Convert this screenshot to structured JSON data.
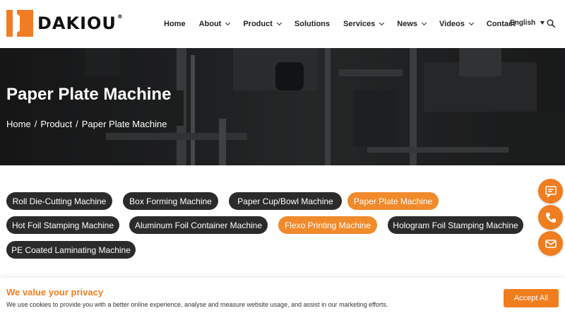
{
  "brand": {
    "name": "DAKIOU",
    "reg": "®",
    "accent": "#f07d1e",
    "dark": "#2b2b2b"
  },
  "nav": {
    "items": [
      {
        "label": "Home",
        "has_dropdown": false
      },
      {
        "label": "About",
        "has_dropdown": true
      },
      {
        "label": "Product",
        "has_dropdown": true
      },
      {
        "label": "Solutions",
        "has_dropdown": false
      },
      {
        "label": "Services",
        "has_dropdown": true
      },
      {
        "label": "News",
        "has_dropdown": true
      },
      {
        "label": "Videos",
        "has_dropdown": true
      },
      {
        "label": "Contact",
        "has_dropdown": false
      }
    ],
    "language": "English",
    "search_icon": "search-icon"
  },
  "hero": {
    "title": "Paper Plate Machine",
    "breadcrumb": [
      "Home",
      "/",
      "Product",
      "/",
      "Paper Plate Machine"
    ]
  },
  "categories": [
    {
      "label": "Roll Die-Cutting Machine",
      "active": false
    },
    {
      "label": "Box Forming Machine",
      "active": false
    },
    {
      "label": "Paper Cup/Bowl Machine",
      "active": false
    },
    {
      "label": "Paper Plate Machine",
      "active": true
    },
    {
      "label": "Hot Foil Stamping Machine",
      "active": false
    },
    {
      "label": "Aluminum Foil Container Machine",
      "active": false
    },
    {
      "label": "Flexo Printing Machine",
      "active": true
    },
    {
      "label": "Hologram Foil Stamping Machine",
      "active": false
    },
    {
      "label": "PE Coated Laminating Machine",
      "active": false
    }
  ],
  "floating_actions": [
    "message-icon",
    "phone-icon",
    "email-icon"
  ],
  "cookie": {
    "title": "We value your privacy",
    "text": "We use cookies to provide you with a better online experience, analyse and measure website usage, and assist in our marketing efforts.",
    "accept_label": "Accept All"
  }
}
